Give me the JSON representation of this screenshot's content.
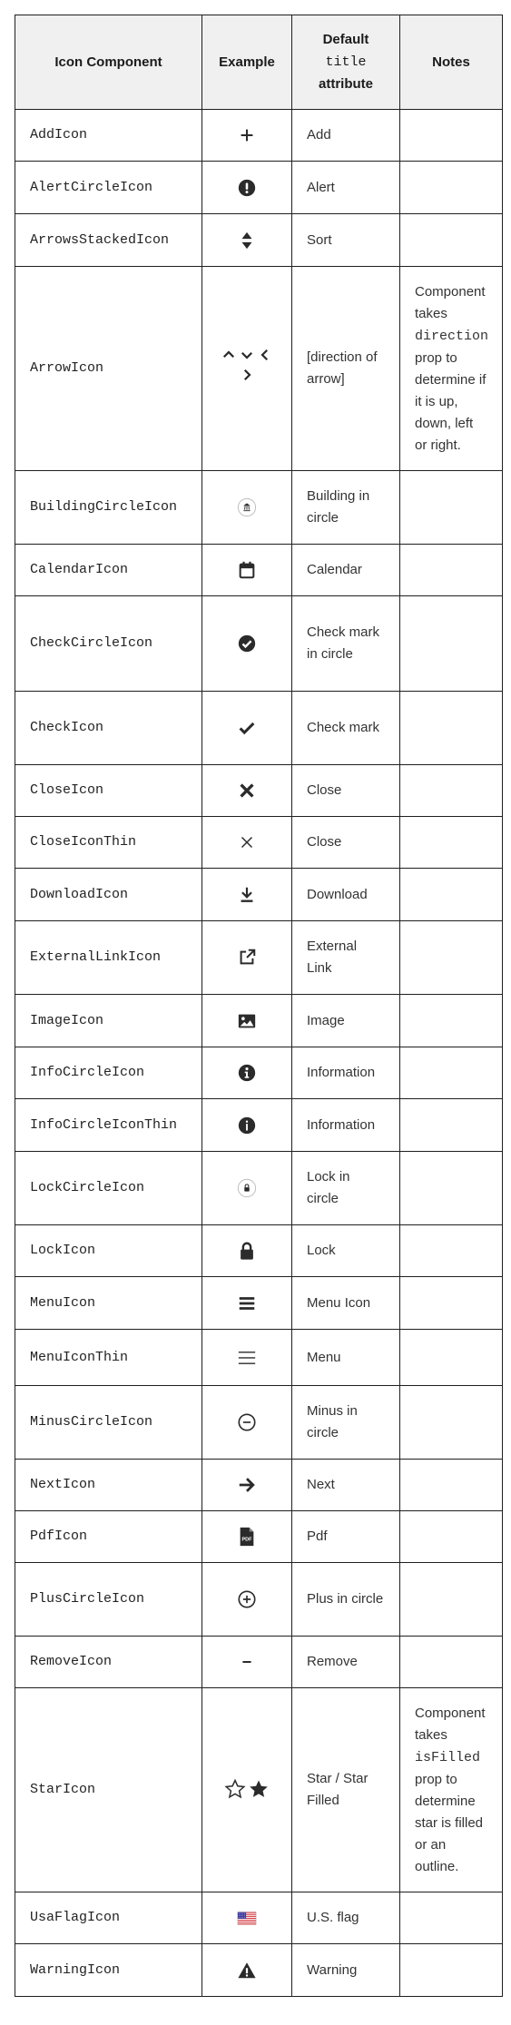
{
  "header": {
    "col1": "Icon Component",
    "col2": "Example",
    "col3_line1": "Default",
    "col3_mono": "title",
    "col3_line3": "attribute",
    "col4": "Notes"
  },
  "rows": [
    {
      "name": "AddIcon",
      "title": "Add",
      "icon": "plus-icon"
    },
    {
      "name": "AlertCircleIcon",
      "title": "Alert",
      "icon": "alert-circle-icon"
    },
    {
      "name": "ArrowsStackedIcon",
      "title": "Sort",
      "icon": "arrows-stacked-icon"
    },
    {
      "name": "ArrowIcon",
      "title": "[direction of arrow]",
      "icon": "arrow-directions-icon",
      "notes_pre": "Component takes",
      "notes_mono": "direction",
      "notes_post": "prop to determine if it is up, down, left or right."
    },
    {
      "name": "BuildingCircleIcon",
      "title": "Building in circle",
      "icon": "building-circle-icon"
    },
    {
      "name": "CalendarIcon",
      "title": "Calendar",
      "icon": "calendar-icon"
    },
    {
      "name": "CheckCircleIcon",
      "title": "Check mark in circle",
      "icon": "check-circle-icon"
    },
    {
      "name": "CheckIcon",
      "title": "Check mark",
      "icon": "check-icon"
    },
    {
      "name": "CloseIcon",
      "title": "Close",
      "icon": "close-icon"
    },
    {
      "name": "CloseIconThin",
      "title": "Close",
      "icon": "close-thin-icon"
    },
    {
      "name": "DownloadIcon",
      "title": "Download",
      "icon": "download-icon"
    },
    {
      "name": "ExternalLinkIcon",
      "title": "External Link",
      "icon": "external-link-icon"
    },
    {
      "name": "ImageIcon",
      "title": "Image",
      "icon": "image-icon"
    },
    {
      "name": "InfoCircleIcon",
      "title": "Information",
      "icon": "info-circle-icon"
    },
    {
      "name": "InfoCircleIconThin",
      "title": "Information",
      "icon": "info-circle-thin-icon"
    },
    {
      "name": "LockCircleIcon",
      "title": "Lock in circle",
      "icon": "lock-circle-icon"
    },
    {
      "name": "LockIcon",
      "title": "Lock",
      "icon": "lock-icon"
    },
    {
      "name": "MenuIcon",
      "title": "Menu Icon",
      "icon": "menu-icon"
    },
    {
      "name": "MenuIconThin",
      "title": "Menu",
      "icon": "menu-thin-icon"
    },
    {
      "name": "MinusCircleIcon",
      "title": "Minus in circle",
      "icon": "minus-circle-icon"
    },
    {
      "name": "NextIcon",
      "title": "Next",
      "icon": "next-arrow-icon"
    },
    {
      "name": "PdfIcon",
      "title": "Pdf",
      "icon": "pdf-icon"
    },
    {
      "name": "PlusCircleIcon",
      "title": "Plus in circle",
      "icon": "plus-circle-icon"
    },
    {
      "name": "RemoveIcon",
      "title": "Remove",
      "icon": "minus-icon"
    },
    {
      "name": "StarIcon",
      "title": "Star / Star Filled",
      "icon": "star-icon",
      "notes_pre": "Component takes",
      "notes_mono": "isFilled",
      "notes_post": "prop to determine star is filled or an outline."
    },
    {
      "name": "UsaFlagIcon",
      "title": "U.S. flag",
      "icon": "usa-flag-icon"
    },
    {
      "name": "WarningIcon",
      "title": "Warning",
      "icon": "warning-icon"
    }
  ],
  "pdf_label": "PDF",
  "colors": {
    "icon": "#2b2b2b",
    "header_bg": "#f0f0f0",
    "border": "#1f1f1f",
    "flag_blue": "#3c3b9e",
    "flag_red": "#d0343b"
  }
}
